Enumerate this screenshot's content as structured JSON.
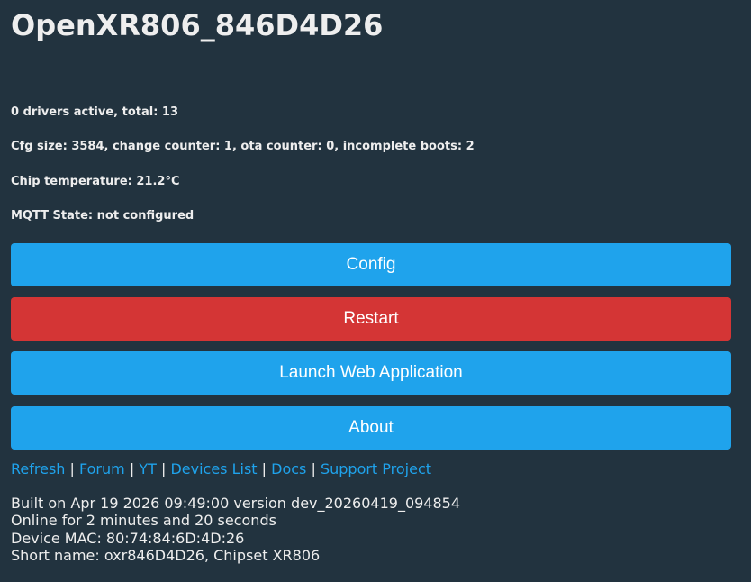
{
  "header": {
    "title": "OpenXR806_846D4D26"
  },
  "status": {
    "drivers": "0 drivers active, total: 13",
    "cfg": "Cfg size: 3584, change counter: 1, ota counter: 0, incomplete boots: 2",
    "temperature": "Chip temperature: 21.2°C",
    "mqtt": "MQTT State: not configured"
  },
  "buttons": {
    "config": "Config",
    "restart": "Restart",
    "launch_web_app": "Launch Web Application",
    "about": "About"
  },
  "links": {
    "refresh": "Refresh",
    "forum": "Forum",
    "yt": "YT",
    "devices_list": "Devices List",
    "docs": "Docs",
    "support_project": "Support Project",
    "separator": "|"
  },
  "footer": {
    "built": "Built on Apr 19 2026 09:49:00 version dev_20260419_094854",
    "online": "Online for 2 minutes and 20 seconds",
    "mac": "Device MAC: 80:74:84:6D:4D:26",
    "short_name": "Short name: oxr846D4D26, Chipset XR806"
  },
  "colors": {
    "background": "#22333f",
    "text": "#eeeeee",
    "primary_button": "#1fa3ec",
    "danger_button": "#d43535",
    "link": "#1fa3ec"
  }
}
